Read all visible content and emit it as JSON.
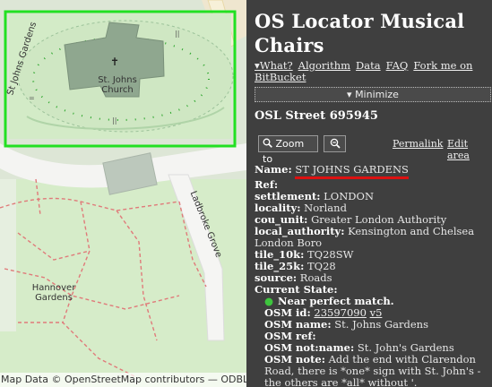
{
  "map": {
    "labels": {
      "street_rot": "St Johns Gardens",
      "church_line1": "St. Johns",
      "church_line2": "Church",
      "church_cross": "✝",
      "road": "Ladbroke Grove",
      "area_line1": "Hannover",
      "area_line2": "Gardens"
    },
    "attribution": "Map Data © OpenStreetMap contributors — ODBL",
    "colors": {
      "selection": "#22e022",
      "footway": "#e07a7a",
      "road": "#f5f5f5",
      "building": "#8aa48a",
      "park": "#cfe8c0"
    }
  },
  "panel": {
    "title": "OS Locator Musical Chairs",
    "nav": {
      "what": "▾What?",
      "algorithm": "Algorithm",
      "data": "Data",
      "faq": "FAQ",
      "fork_line1": "Fork me on",
      "fork_line2": "BitBucket"
    },
    "minimize": "▾ Minimize",
    "street_title": "OSL Street 695945",
    "controls": {
      "zoom_to": "Zoom to",
      "zoom_to_icon": "magnifier-icon",
      "zoom_out_icon": "magnifier-minus-icon",
      "permalink": "Permalink",
      "edit_area": "Edit area"
    },
    "details": {
      "name_label": "Name:",
      "name_value": "ST JOHNS GARDENS",
      "ref_label": "Ref:",
      "settlement_label": "settlement:",
      "settlement_value": "LONDON",
      "locality_label": "locality:",
      "locality_value": "Norland",
      "cou_unit_label": "cou_unit:",
      "cou_unit_value": "Greater London Authority",
      "local_authority_label": "local_authority:",
      "local_authority_value": "Kensington and Chelsea London Boro",
      "tile_10k_label": "tile_10k:",
      "tile_10k_value": "TQ28SW",
      "tile_25k_label": "tile_25k:",
      "tile_25k_value": "TQ28",
      "source_label": "source:",
      "source_value": "Roads",
      "current_state_label": "Current State:",
      "match_text": "Near perfect match.",
      "osm_id_label": "OSM id:",
      "osm_id_value": "23597090",
      "osm_version": "v5",
      "osm_name_label": "OSM name:",
      "osm_name_value": "St. Johns Gardens",
      "osm_ref_label": "OSM ref:",
      "osm_notname_label": "OSM not:name:",
      "osm_notname_value": "St. John's Gardens",
      "osm_note_label": "OSM note:",
      "osm_note_value": "Add the end with Clarendon Road, there is *one* sign with St. John's - the others are *all* without '."
    }
  }
}
